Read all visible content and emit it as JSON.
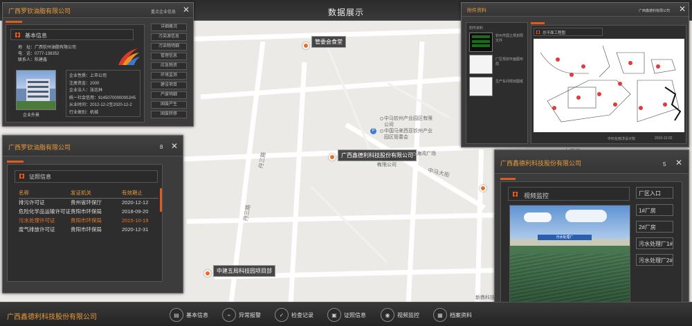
{
  "topbar": {
    "title": "数据展示"
  },
  "map": {
    "roads": [
      "丹三路",
      "丹三路",
      "中马大街",
      "力岗南"
    ],
    "pois": [
      "中马钦州产业园区有限公司",
      "中国马来西亚钦州产业园区管委会",
      "海湾广场",
      "广西鑫德利科技有限公司",
      "新鼎科技",
      "广西鑫德利科技有限公司"
    ],
    "markers": [
      {
        "label": "管委会食堂"
      },
      {
        "label": "广西鑫德利科技股份有限公司"
      },
      {
        "label": "中建五局科技园项目部"
      }
    ]
  },
  "panel_basic": {
    "company": "广西罗钦油脂有限公司",
    "extra_link": "重点企业信息",
    "section_title": "基本信息",
    "contact_lines": [
      "地　址：广西钦州油脂有限公司",
      "电　话：0777-13835⁢2",
      "联系人：陈建鑫"
    ],
    "photo_caption": "企业外景",
    "details": [
      "企业性质：上市公司",
      "注册资金：2000",
      "企业法人：张志林",
      "统一社会信用：9145070000000JH5",
      "从业时间：2012-12-2至2020-12-2",
      "行业类别：机械"
    ],
    "side_buttons": [
      "详细概况",
      "污染源信息",
      "污染物明细",
      "管理信息",
      "应急物资",
      "环境监测",
      "建设项目",
      "产废明细",
      "固废产生",
      "固废转移"
    ]
  },
  "panel_cert": {
    "company": "广西罗钦油脂有限公司",
    "count": "8",
    "section_title": "证照信息",
    "columns": [
      "名称",
      "发证机关",
      "有效期止"
    ],
    "rows": [
      {
        "name": "排污许可证",
        "org": "贵州省环保厅",
        "date": "2020-12-12",
        "highlight": false
      },
      {
        "name": "危险化学品运输许可证",
        "org": "贵阳市环保局",
        "date": "2018-09-20",
        "highlight": false
      },
      {
        "name": "污水处理许可证",
        "org": "贵阳市环保局",
        "date": "2015-10-19",
        "highlight": true
      },
      {
        "name": "废气排放许可证",
        "org": "贵阳市环保局",
        "date": "2020-12-31",
        "highlight": false
      }
    ]
  },
  "panel_plan": {
    "title": "附件资料",
    "company": "广西鑫德利有限公司",
    "left_title": "附件资料",
    "thumbs": [
      "钦州市国土规划局文件",
      "厂区规划平面图布局",
      "生产车间规划图纸"
    ],
    "section_title": "总平面工程图",
    "caption_left": "中石化南洋设计院",
    "caption_date": "2010-12-02"
  },
  "panel_camera": {
    "company": "广西鑫德利科技股份有限公司",
    "count": "5",
    "section_title": "视频监控",
    "cameras": [
      "厂区入口",
      "1#厂房",
      "2#厂房",
      "污水处理厂1#",
      "污水处理厂2#"
    ],
    "video_sign": "污水处理厂"
  },
  "bottombar": {
    "company": "广西鑫德利科技股份有限公司",
    "nav": [
      {
        "label": "基本信息",
        "icon": "document-icon"
      },
      {
        "label": "异常报警",
        "icon": "monitor-alert-icon"
      },
      {
        "label": "检查记录",
        "icon": "checklist-icon"
      },
      {
        "label": "证照信息",
        "icon": "briefcase-icon"
      },
      {
        "label": "视频监控",
        "icon": "camera-icon"
      },
      {
        "label": "档案资料",
        "icon": "archive-icon"
      }
    ]
  }
}
